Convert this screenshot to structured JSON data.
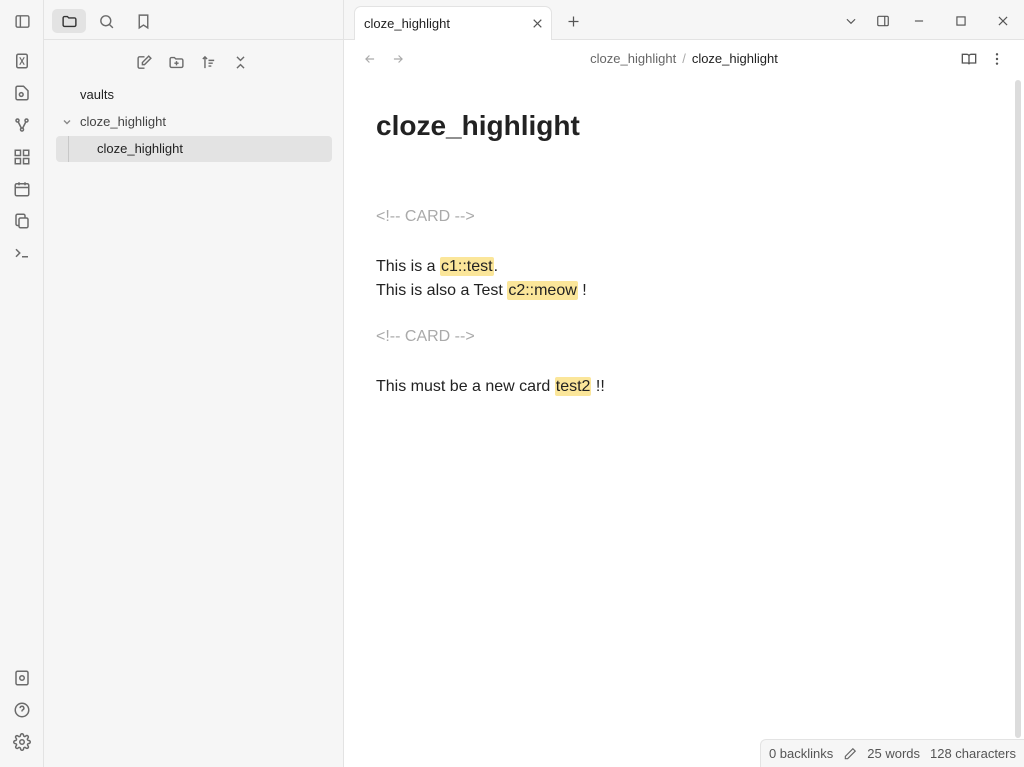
{
  "sidebar": {
    "tree": {
      "root": "vaults",
      "folder": "cloze_highlight",
      "file": "cloze_highlight"
    }
  },
  "tab": {
    "title": "cloze_highlight"
  },
  "breadcrumb": {
    "parent": "cloze_highlight",
    "separator": "/",
    "current": "cloze_highlight"
  },
  "note": {
    "title": "cloze_highlight",
    "comment1": "<!-- CARD -->",
    "line1_pre": "This is a ",
    "line1_hl": "c1::test",
    "line1_post": ".",
    "line2_pre": "This is also a Test ",
    "line2_hl": "c2::meow",
    "line2_post": " !",
    "comment2": "<!-- CARD -->",
    "line3_pre": "This must be a new card ",
    "line3_hl": "test2",
    "line3_post": " !!"
  },
  "status": {
    "backlinks": "0 backlinks",
    "words": "25 words",
    "characters": "128 characters"
  },
  "colors": {
    "highlight": "#fbe69a",
    "sidebar_bg": "#f6f6f6",
    "active_item_bg": "#e3e3e3",
    "comment_text": "#aaaaaa"
  }
}
